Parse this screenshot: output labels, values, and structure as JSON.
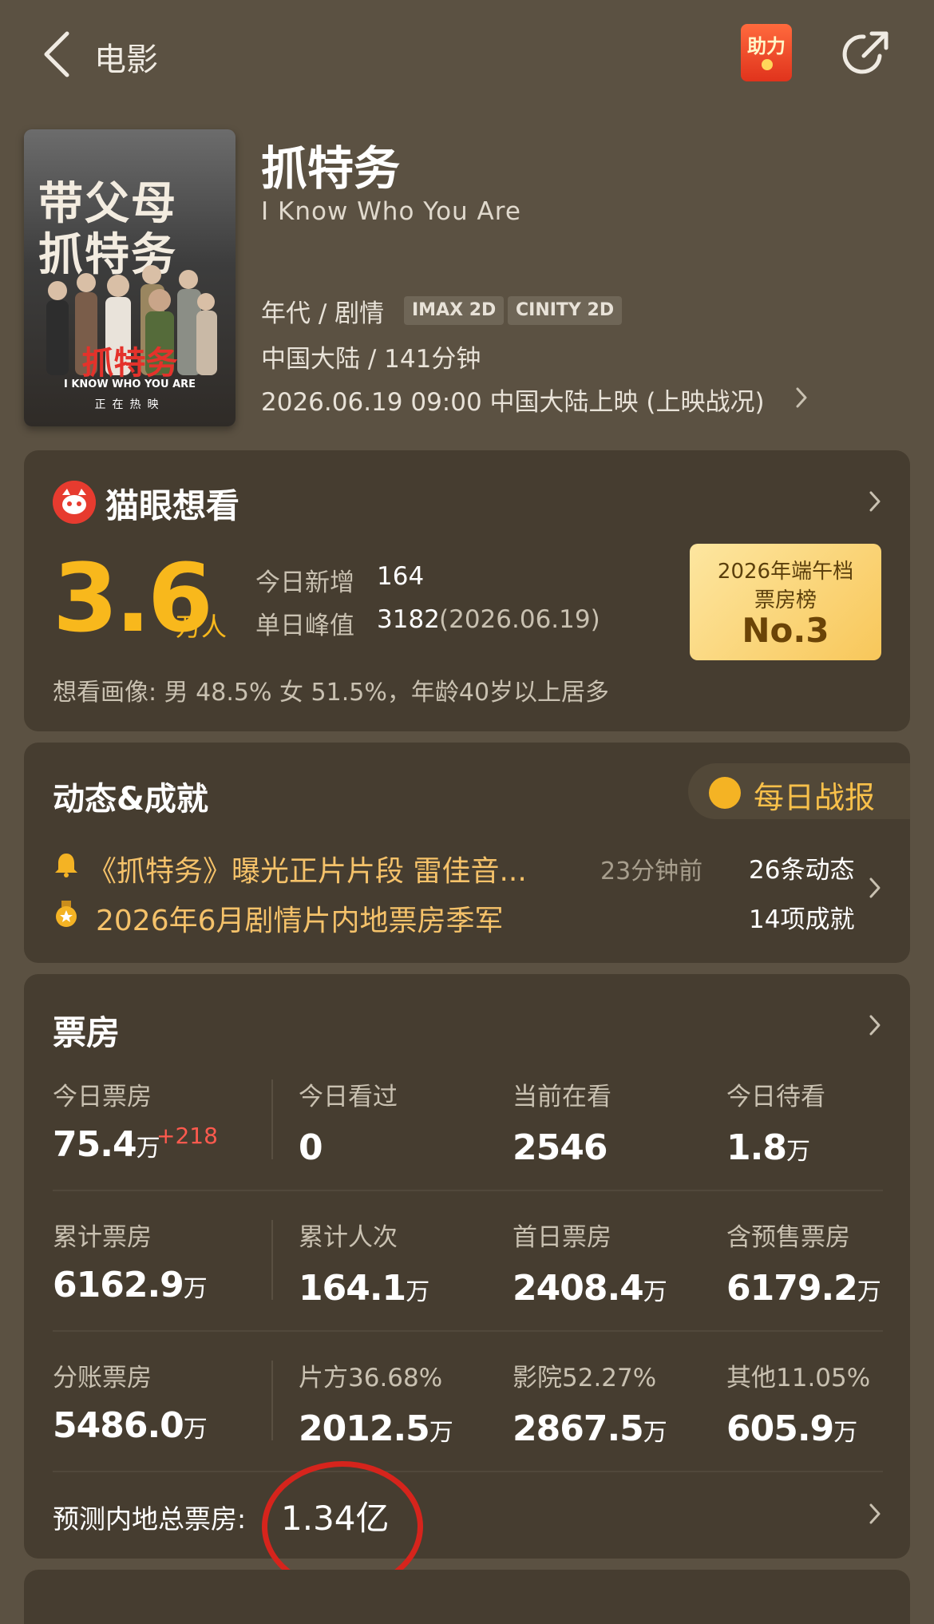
{
  "header": {
    "back_label": "电影",
    "help_label": "助力",
    "icons": {
      "back": "chevron-left-icon",
      "share": "share-icon"
    }
  },
  "poster": {
    "line1": "带父母",
    "line2": "抓特务",
    "logo": "抓特务",
    "en": "I KNOW WHO YOU ARE",
    "tag": "正在热映"
  },
  "movie": {
    "title": "抓特务",
    "title_en": "I Know Who You Are",
    "genre": "年代 / 剧情",
    "formats": [
      "IMAX 2D",
      "CINITY 2D"
    ],
    "region_runtime": "中国大陆 / 141分钟",
    "release": "2026.06.19 09:00 中国大陆上映 (上映战况)"
  },
  "want": {
    "title": "猫眼想看",
    "count": "3.6",
    "unit": "万人",
    "today_label": "今日新增",
    "today_value": "164",
    "peak_label": "单日峰值",
    "peak_value": "3182",
    "peak_date": "(2026.06.19)",
    "rank_line1": "2026年端午档",
    "rank_line2": "票房榜",
    "rank_line3": "No.3",
    "portrait": "想看画像: 男 48.5%  女 51.5%，年龄40岁以上居多"
  },
  "news": {
    "title": "动态&成就",
    "daily_label": "每日战报",
    "item1": "《抓特务》曝光正片片段 雷佳音...",
    "item1_time": "23分钟前",
    "item2": "2026年6月剧情片内地票房季军",
    "news_count": "26条动态",
    "ach_count": "14项成就"
  },
  "boxoffice": {
    "title": "票房",
    "rows": [
      [
        {
          "label": "今日票房",
          "value": "75.4",
          "unit": "万",
          "delta": "+218"
        },
        {
          "label": "今日看过",
          "value": "0",
          "unit": ""
        },
        {
          "label": "当前在看",
          "value": "2546",
          "unit": ""
        },
        {
          "label": "今日待看",
          "value": "1.8",
          "unit": "万"
        }
      ],
      [
        {
          "label": "累计票房",
          "value": "6162.9",
          "unit": "万"
        },
        {
          "label": "累计人次",
          "value": "164.1",
          "unit": "万"
        },
        {
          "label": "首日票房",
          "value": "2408.4",
          "unit": "万"
        },
        {
          "label": "含预售票房",
          "value": "6179.2",
          "unit": "万"
        }
      ],
      [
        {
          "label": "分账票房",
          "value": "5486.0",
          "unit": "万"
        },
        {
          "label": "片方36.68%",
          "value": "2012.5",
          "unit": "万"
        },
        {
          "label": "影院52.27%",
          "value": "2867.5",
          "unit": "万"
        },
        {
          "label": "其他11.05%",
          "value": "605.9",
          "unit": "万"
        }
      ]
    ],
    "predict_label": "预测内地总票房:",
    "predict_value": "1.34亿"
  }
}
